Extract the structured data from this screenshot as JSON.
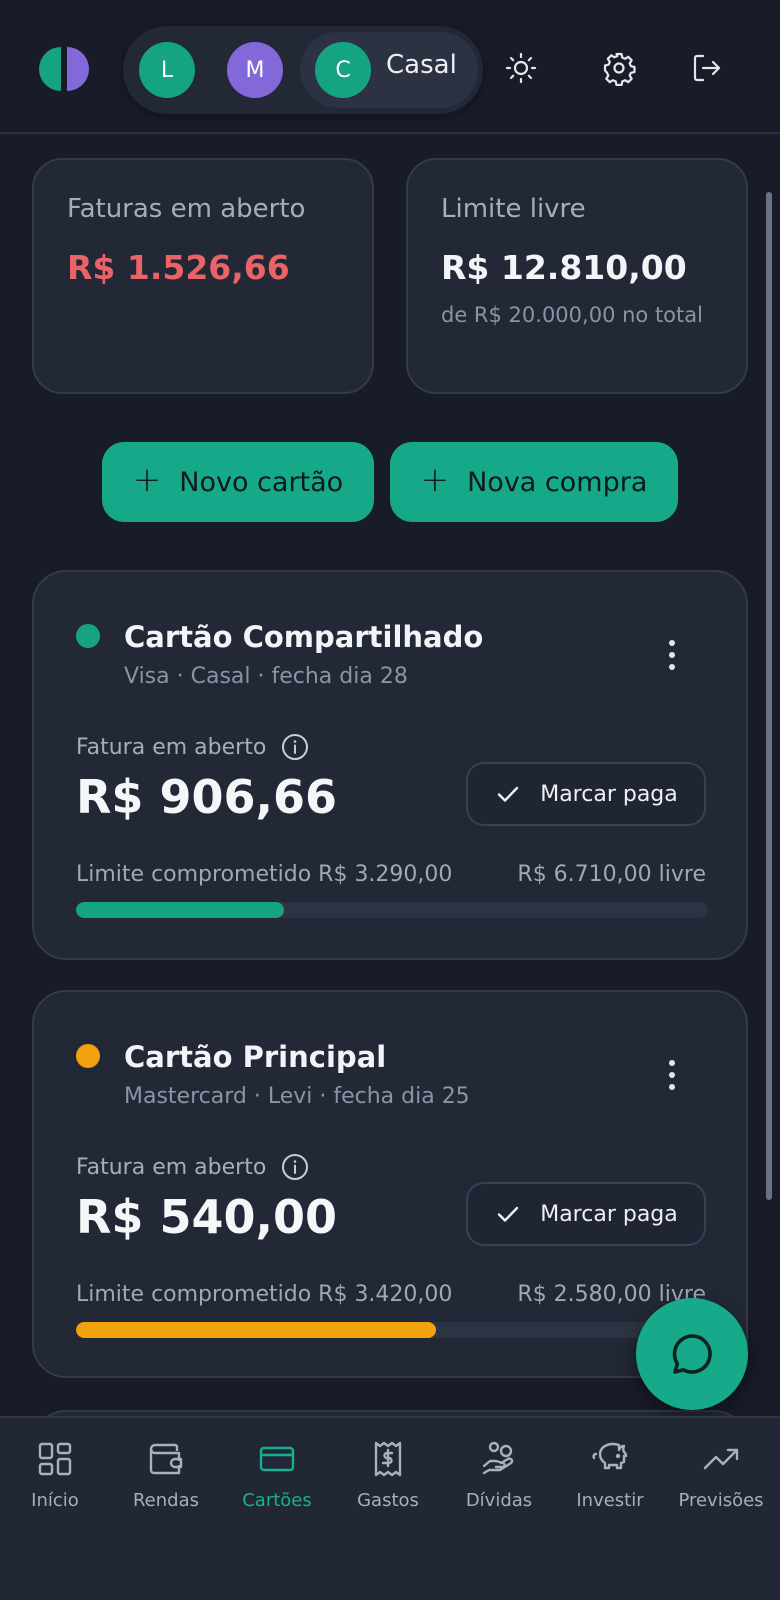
{
  "header": {
    "profiles": [
      {
        "initial": "L",
        "color": "#15a384"
      },
      {
        "initial": "M",
        "color": "#8268d8"
      },
      {
        "initial": "C",
        "color": "#15a384"
      }
    ],
    "active_profile_label": "Casal"
  },
  "summary": {
    "open_invoices": {
      "title": "Faturas em aberto",
      "value": "R$ 1.526,66",
      "color": "#ea6366"
    },
    "free_limit": {
      "title": "Limite livre",
      "value": "R$ 12.810,00",
      "subtitle": "de R$ 20.000,00 no total"
    }
  },
  "actions": {
    "new_card": "Novo cartão",
    "new_purchase": "Nova compra"
  },
  "cards": [
    {
      "name": "Cartão Compartilhado",
      "meta": "Visa · Casal · fecha dia 28",
      "dot_color": "#15a384",
      "invoice_label": "Fatura em aberto",
      "invoice_value": "R$ 906,66",
      "mark_paid": "Marcar paga",
      "limit_used": "Limite comprometido R$ 3.290,00",
      "limit_free": "R$ 6.710,00 livre",
      "usage_fraction": 0.329,
      "bar_color": "#15a384"
    },
    {
      "name": "Cartão Principal",
      "meta": "Mastercard · Levi · fecha dia 25",
      "dot_color": "#f2a20e",
      "invoice_label": "Fatura em aberto",
      "invoice_value": "R$ 540,00",
      "mark_paid": "Marcar paga",
      "limit_used": "Limite comprometido R$ 3.420,00",
      "limit_free": "R$ 2.580,00 livre",
      "usage_fraction": 0.57,
      "bar_color": "#f2a20e"
    }
  ],
  "bottom_nav": [
    {
      "label": "Início",
      "icon": "grid-icon"
    },
    {
      "label": "Rendas",
      "icon": "wallet-icon"
    },
    {
      "label": "Cartões",
      "icon": "credit-card-icon",
      "active": true
    },
    {
      "label": "Gastos",
      "icon": "receipt-icon"
    },
    {
      "label": "Dívidas",
      "icon": "hand-coins-icon"
    },
    {
      "label": "Investir",
      "icon": "piggy-bank-icon"
    },
    {
      "label": "Previsões",
      "icon": "trending-up-icon"
    }
  ],
  "accent_color": "#15a98a"
}
